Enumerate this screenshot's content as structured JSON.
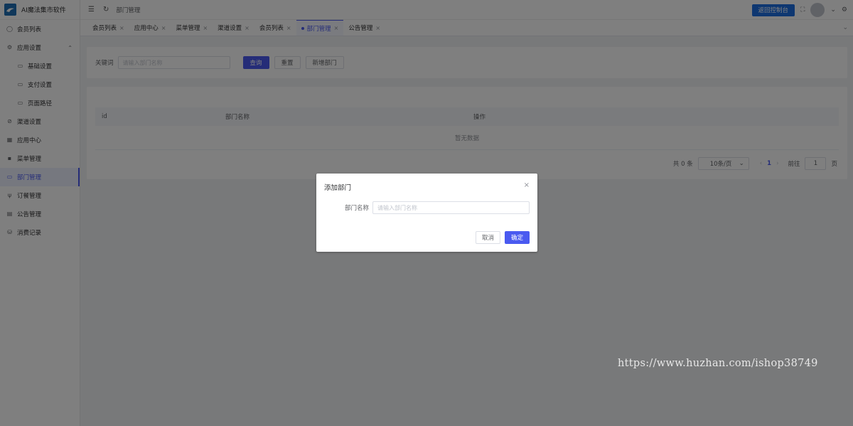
{
  "app": {
    "title": "AI魔法集市软件"
  },
  "sidebar": {
    "items": [
      {
        "label": "会员列表",
        "icon": "user-circle-icon"
      },
      {
        "label": "应用设置",
        "icon": "gear-icon"
      },
      {
        "label": "基础设置",
        "icon": "folder-icon"
      },
      {
        "label": "支付设置",
        "icon": "folder-icon"
      },
      {
        "label": "页面路径",
        "icon": "folder-icon"
      },
      {
        "label": "渠道设置",
        "icon": "compass-icon"
      },
      {
        "label": "应用中心",
        "icon": "grid-icon"
      },
      {
        "label": "菜单管理",
        "icon": "apps-icon"
      },
      {
        "label": "部门管理",
        "icon": "folder-icon"
      },
      {
        "label": "订餐管理",
        "icon": "fork-icon"
      },
      {
        "label": "公告管理",
        "icon": "document-icon"
      },
      {
        "label": "消费记录",
        "icon": "database-icon"
      }
    ]
  },
  "header": {
    "breadcrumb": "部门管理",
    "console_button": "返回控制台"
  },
  "tabs": [
    {
      "label": "会员列表",
      "active": false
    },
    {
      "label": "应用中心",
      "active": false
    },
    {
      "label": "菜单管理",
      "active": false
    },
    {
      "label": "渠道设置",
      "active": false
    },
    {
      "label": "会员列表",
      "active": false
    },
    {
      "label": "部门管理",
      "active": true
    },
    {
      "label": "公告管理",
      "active": false
    }
  ],
  "search": {
    "keyword_label": "关键词",
    "keyword_placeholder": "请输入部门名称",
    "query_button": "查询",
    "reset_button": "重置",
    "add_button": "新增部门"
  },
  "table": {
    "columns": [
      "id",
      "部门名称",
      "操作"
    ],
    "empty_text": "暂无数据"
  },
  "pagination": {
    "total_text": "共 0 条",
    "page_size": "10条/页",
    "current_page": "1",
    "goto_label": "前往",
    "goto_value": "1",
    "page_suffix": "页"
  },
  "dialog": {
    "title": "添加部门",
    "field_label": "部门名称",
    "field_placeholder": "请输入部门名称",
    "cancel_button": "取消",
    "confirm_button": "确定"
  },
  "watermark": "https://www.huzhan.com/ishop38749",
  "colors": {
    "primary": "#4a5af0",
    "console": "#1d6fe3"
  }
}
